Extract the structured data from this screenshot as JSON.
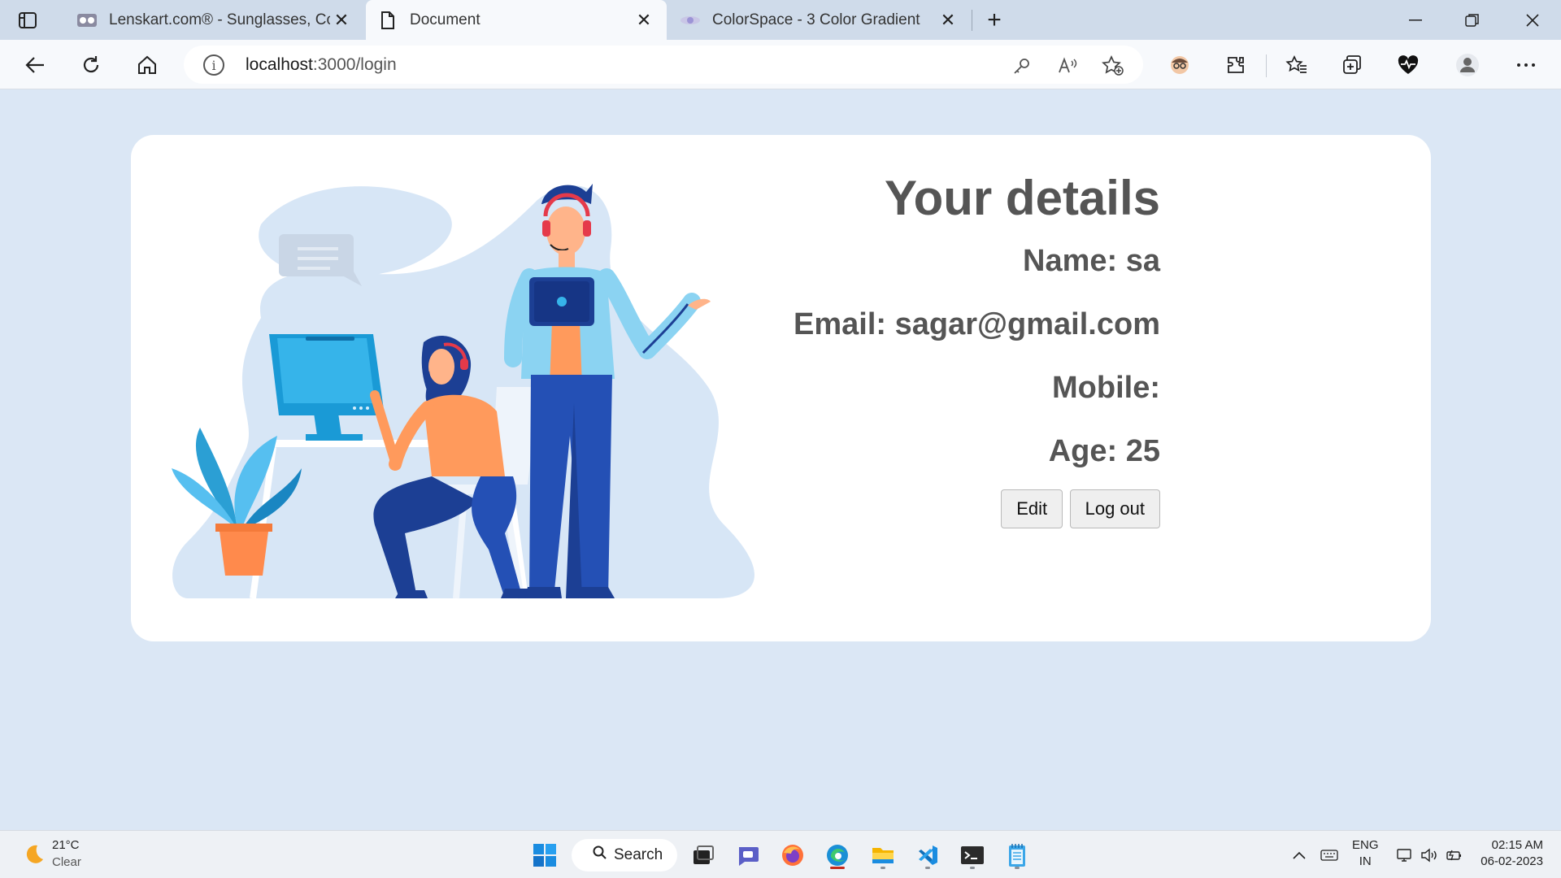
{
  "browser": {
    "tabs": [
      {
        "title": "Lenskart.com® - Sunglasses, Cor",
        "active": false
      },
      {
        "title": "Document",
        "active": true
      },
      {
        "title": "ColorSpace - 3 Color Gradient",
        "active": false
      }
    ],
    "address": {
      "host": "localhost",
      "path": ":3000/login"
    }
  },
  "page": {
    "heading": "Your details",
    "fields": {
      "name": "Name: sa",
      "email": "Email: sagar@gmail.com",
      "mobile": "Mobile:",
      "age": "Age: 25"
    },
    "buttons": {
      "edit": "Edit",
      "logout": "Log out"
    }
  },
  "taskbar": {
    "weather": {
      "temp": "21°C",
      "condition": "Clear"
    },
    "search_label": "Search",
    "language": {
      "line1": "ENG",
      "line2": "IN"
    },
    "clock": {
      "time": "02:15 AM",
      "date": "06-02-2023"
    }
  },
  "colors": {
    "page_bg": "#dbe7f5",
    "card_bg": "#ffffff",
    "text": "#555555",
    "accent_blue": "#1a9ad6",
    "accent_orange": "#ff8a4c",
    "navy": "#1c3f94"
  }
}
